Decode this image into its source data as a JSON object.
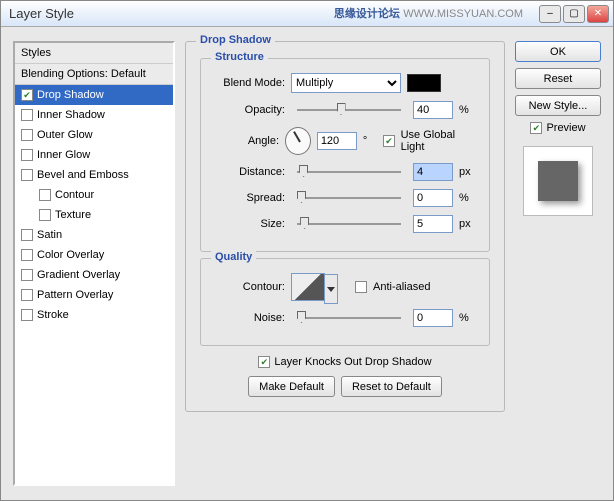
{
  "window": {
    "title": "Layer Style",
    "watermark_a": "思缘设计论坛",
    "watermark_b": "WWW.MISSYUAN.COM"
  },
  "styles": {
    "header": "Styles",
    "blending": "Blending Options: Default",
    "items": [
      {
        "label": "Drop Shadow",
        "checked": true,
        "selected": true
      },
      {
        "label": "Inner Shadow",
        "checked": false
      },
      {
        "label": "Outer Glow",
        "checked": false
      },
      {
        "label": "Inner Glow",
        "checked": false
      },
      {
        "label": "Bevel and Emboss",
        "checked": false
      },
      {
        "label": "Contour",
        "checked": false,
        "sub": true
      },
      {
        "label": "Texture",
        "checked": false,
        "sub": true
      },
      {
        "label": "Satin",
        "checked": false
      },
      {
        "label": "Color Overlay",
        "checked": false
      },
      {
        "label": "Gradient Overlay",
        "checked": false
      },
      {
        "label": "Pattern Overlay",
        "checked": false
      },
      {
        "label": "Stroke",
        "checked": false
      }
    ]
  },
  "dropshadow": {
    "title": "Drop Shadow",
    "structure": {
      "title": "Structure",
      "blend_mode_label": "Blend Mode:",
      "blend_mode_value": "Multiply",
      "opacity_label": "Opacity:",
      "opacity_value": "40",
      "opacity_unit": "%",
      "angle_label": "Angle:",
      "angle_value": "120",
      "angle_unit": "°",
      "use_global": "Use Global Light",
      "distance_label": "Distance:",
      "distance_value": "4",
      "distance_unit": "px",
      "spread_label": "Spread:",
      "spread_value": "0",
      "spread_unit": "%",
      "size_label": "Size:",
      "size_value": "5",
      "size_unit": "px"
    },
    "quality": {
      "title": "Quality",
      "contour_label": "Contour:",
      "antialiased": "Anti-aliased",
      "noise_label": "Noise:",
      "noise_value": "0",
      "noise_unit": "%"
    },
    "knocks_out": "Layer Knocks Out Drop Shadow",
    "make_default": "Make Default",
    "reset_default": "Reset to Default"
  },
  "buttons": {
    "ok": "OK",
    "reset": "Reset",
    "new_style": "New Style...",
    "preview": "Preview"
  }
}
